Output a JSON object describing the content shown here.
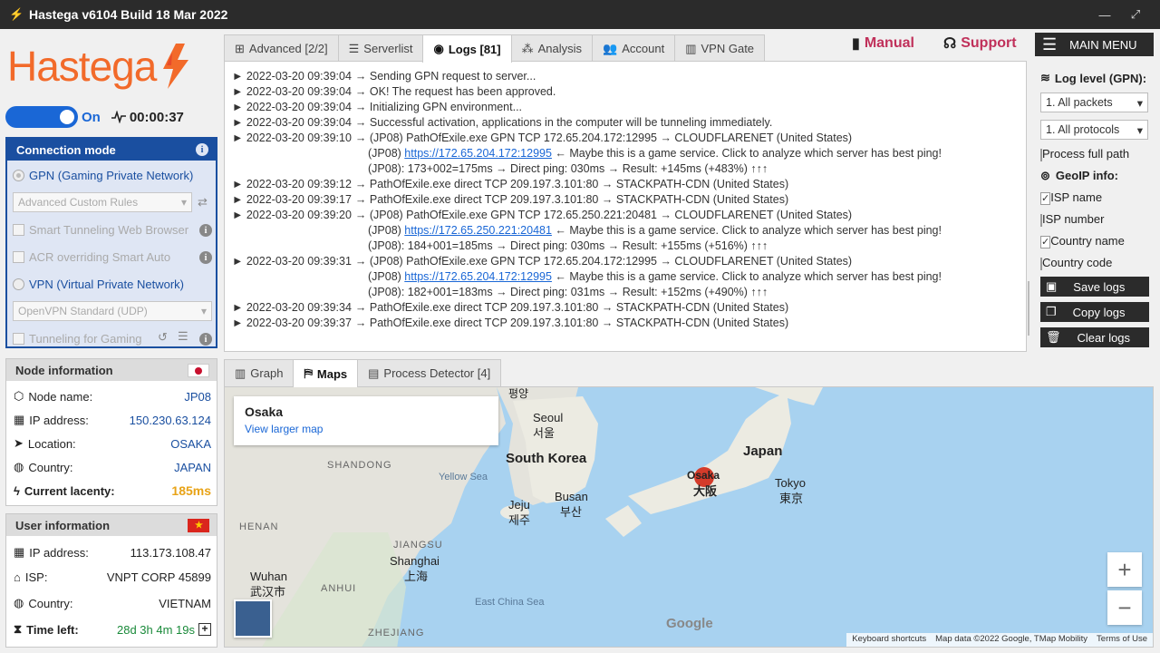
{
  "window": {
    "title": "Hastega v6104 Build 18 Mar 2022",
    "minimize": "—",
    "maximize": "⤢",
    "close": "✕"
  },
  "logo": {
    "word": "Hastega",
    "brand_color": "#f26a2a"
  },
  "status": {
    "toggle": "On",
    "timer": "00:00:37"
  },
  "connection": {
    "title": "Connection mode",
    "info": "i",
    "gpn_label": "GPN (Gaming Private Network)",
    "rules_select": "Advanced Custom Rules",
    "smart_tunneling": "Smart Tunneling Web Browser",
    "acr_override": "ACR overriding Smart Auto",
    "vpn_label": "VPN (Virtual Private Network)",
    "vpn_select": "OpenVPN Standard (UDP)",
    "tunneling_gaming": "Tunneling for Gaming"
  },
  "node": {
    "title": "Node information",
    "rows": [
      {
        "key": "Node name:",
        "value": "JP08"
      },
      {
        "key": "IP address:",
        "value": "150.230.63.124"
      },
      {
        "key": "Location:",
        "value": "OSAKA"
      },
      {
        "key": "Country:",
        "value": "JAPAN"
      },
      {
        "key": "Current lacenty:",
        "value": "185ms"
      }
    ]
  },
  "user": {
    "title": "User information",
    "rows": [
      {
        "key": "IP address:",
        "value": "113.173.108.47"
      },
      {
        "key": "ISP:",
        "value": "VNPT CORP 45899"
      },
      {
        "key": "Country:",
        "value": "VIETNAM"
      },
      {
        "key": "Time left:",
        "value": "28d 3h 4m 19s"
      }
    ]
  },
  "tabs": [
    "Advanced [2/2]",
    "Serverlist",
    "Logs [81]",
    "Analysis",
    "Account",
    "VPN Gate"
  ],
  "header": {
    "manual": "Manual",
    "support": "Support",
    "main_menu": "MAIN MENU"
  },
  "logs": [
    {
      "ts": "► 2022-03-20 09:39:04",
      "text": "→ Sending GPN request to server..."
    },
    {
      "ts": "► 2022-03-20 09:39:04",
      "text": "→ OK! The request has been approved."
    },
    {
      "ts": "► 2022-03-20 09:39:04",
      "text": "→ Initializing GPN environment..."
    },
    {
      "ts": "► 2022-03-20 09:39:04",
      "text": "→ Successful activation, applications in the computer will be tunneling immediately."
    },
    {
      "ts": "► 2022-03-20 09:39:10",
      "text": "→ (JP08) PathOfExile.exe GPN TCP 172.65.204.172:12995 → CLOUDFLARENET (United States)"
    },
    {
      "pre": "(JP08) ",
      "link": "https://172.65.204.172:12995",
      "text": " ← Maybe this is a game service. Click to analyze which server has best ping!"
    },
    {
      "pre": "(JP08): 173+002=175ms → Direct ping: 030ms → Result: +145ms (+483%) ↑↑↑"
    },
    {
      "ts": "► 2022-03-20 09:39:12",
      "text": "→ PathOfExile.exe direct TCP 209.197.3.101:80 → STACKPATH-CDN (United States)"
    },
    {
      "ts": "► 2022-03-20 09:39:17",
      "text": "→ PathOfExile.exe direct TCP 209.197.3.101:80 → STACKPATH-CDN (United States)"
    },
    {
      "ts": "► 2022-03-20 09:39:20",
      "text": "→ (JP08) PathOfExile.exe GPN TCP 172.65.250.221:20481 → CLOUDFLARENET (United States)"
    },
    {
      "pre": "(JP08) ",
      "link": "https://172.65.250.221:20481",
      "text": " ← Maybe this is a game service. Click to analyze which server has best ping!"
    },
    {
      "pre": "(JP08): 184+001=185ms → Direct ping: 030ms → Result: +155ms (+516%) ↑↑↑"
    },
    {
      "ts": "► 2022-03-20 09:39:31",
      "text": "→ (JP08) PathOfExile.exe GPN TCP 172.65.204.172:12995 → CLOUDFLARENET (United States)"
    },
    {
      "pre": "(JP08) ",
      "link": "https://172.65.204.172:12995",
      "text": " ← Maybe this is a game service. Click to analyze which server has best ping!"
    },
    {
      "pre": "(JP08): 182+001=183ms → Direct ping: 031ms → Result: +152ms (+490%) ↑↑↑"
    },
    {
      "ts": "► 2022-03-20 09:39:34",
      "text": "→ PathOfExile.exe direct TCP 209.197.3.101:80 → STACKPATH-CDN (United States)"
    },
    {
      "ts": "► 2022-03-20 09:39:37",
      "text": "→ PathOfExile.exe direct TCP 209.197.3.101:80 → STACKPATH-CDN (United States)"
    }
  ],
  "side": {
    "log_level_label": "Log level (GPN):",
    "packets_select": "1. All packets",
    "protocols_select": "1. All protocols",
    "process_full_path": "Process full path",
    "geoip_label": "GeoIP info:",
    "isp_name": "ISP name",
    "isp_number": "ISP number",
    "country_name": "Country name",
    "country_code": "Country code",
    "save_logs": "Save logs",
    "copy_logs": "Copy logs",
    "clear_logs": "Clear logs",
    "checked": {
      "process_full_path": false,
      "isp_name": true,
      "isp_number": false,
      "country_name": true,
      "country_code": false
    }
  },
  "bottom_tabs": [
    "Graph",
    "Maps",
    "Process Detector [4]"
  ],
  "map": {
    "card_title": "Osaka",
    "card_link": "View larger map",
    "labels": {
      "pyongyang": "평양",
      "seoul_en": "Seoul",
      "seoul_ko": "서울",
      "south_korea": "South Korea",
      "shandong": "SHANDONG",
      "yellow_sea": "Yellow Sea",
      "jeju_en": "Jeju",
      "jeju_ko": "제주",
      "busan_en": "Busan",
      "busan_ko": "부산",
      "japan": "Japan",
      "osaka_en": "Osaka",
      "osaka_ja": "大阪",
      "tokyo_en": "Tokyo",
      "tokyo_ja": "東京",
      "henan": "HENAN",
      "jiangsu": "JIANGSU",
      "shanghai_en": "Shanghai",
      "shanghai_zh": "上海",
      "wuhan_en": "Wuhan",
      "wuhan_zh": "武汉市",
      "anhui": "ANHUI",
      "east_china_sea": "East China Sea",
      "zhejiang": "ZHEJIANG",
      "google": "Google"
    },
    "zoom_in": "+",
    "zoom_out": "−",
    "attribution": [
      "Keyboard shortcuts",
      "Map data ©2022 Google, TMap Mobility",
      "Terms of Use"
    ]
  },
  "colors": {
    "accent": "#1a67d6",
    "panel_blue": "#1a4fa0",
    "dark": "#2b2b2b",
    "manual": "#c0305a",
    "latency": "#e8a317"
  }
}
